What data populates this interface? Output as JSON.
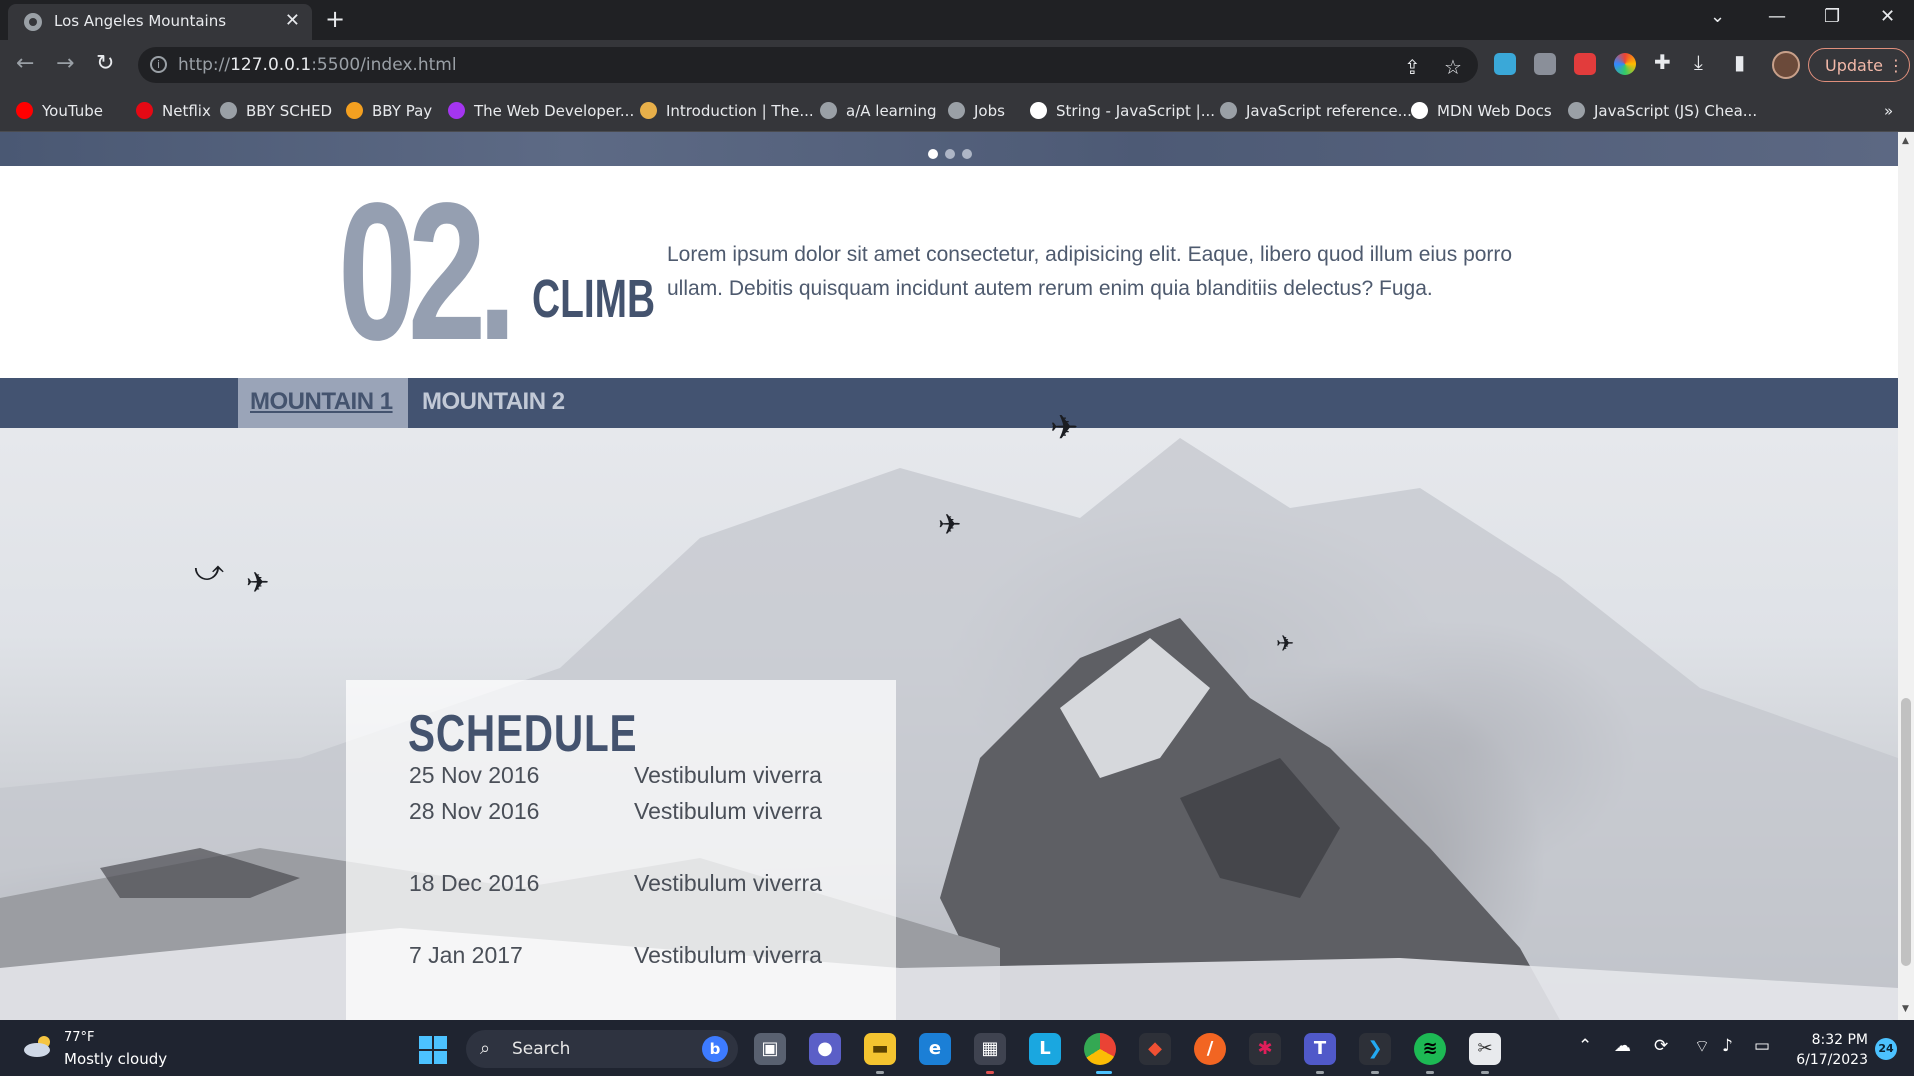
{
  "browser": {
    "tab_title": "Los Angeles Mountains",
    "url_prefix": "http://",
    "url_host": "127.0.0.1",
    "url_rest": ":5500/index.html",
    "update_label": "Update",
    "bookmarks": [
      {
        "label": "YouTube",
        "color": "#ff0000"
      },
      {
        "label": "Netflix",
        "color": "#e50914"
      },
      {
        "label": "BBY SCHED",
        "color": "#9aa0a6"
      },
      {
        "label": "BBY Pay",
        "color": "#f4a020"
      },
      {
        "label": "The Web Developer...",
        "color": "#a435f0"
      },
      {
        "label": "Introduction | The...",
        "color": "#e8b04a"
      },
      {
        "label": "a/A learning",
        "color": "#9aa0a6"
      },
      {
        "label": "Jobs",
        "color": "#9aa0a6"
      },
      {
        "label": "String - JavaScript |...",
        "color": "#ffffff"
      },
      {
        "label": "JavaScript reference...",
        "color": "#9aa0a6"
      },
      {
        "label": "MDN Web Docs",
        "color": "#ffffff"
      },
      {
        "label": "JavaScript (JS) Chea...",
        "color": "#9aa0a6"
      }
    ],
    "bookmarks_overflow": "»"
  },
  "page": {
    "carousel_dots": 3,
    "carousel_active": 1,
    "step_number": "02.",
    "step_label": "CLIMB",
    "step_text": "Lorem ipsum dolor sit amet consectetur, adipisicing elit. Eaque, libero quod illum eius porro ullam. Debitis quisquam incidunt autem rerum enim quia blanditiis delectus? Fuga.",
    "tabs": [
      "MOUNTAIN 1",
      "MOUNTAIN 2"
    ],
    "active_tab": 0,
    "schedule": {
      "title": "SCHEDULE",
      "rows": [
        {
          "date": "25 Nov 2016",
          "desc": "Vestibulum viverra"
        },
        {
          "date": "28 Nov 2016",
          "desc": "Vestibulum viverra"
        },
        {
          "date": "18 Dec 2016",
          "desc": "Vestibulum viverra"
        },
        {
          "date": "7 Jan 2017",
          "desc": "Vestibulum viverra"
        }
      ]
    }
  },
  "taskbar": {
    "weather_temp": "77°F",
    "weather_desc": "Mostly cloudy",
    "search_label": "Search",
    "time": "8:32 PM",
    "date": "6/17/2023",
    "notification_count": "24"
  },
  "colors": {
    "accent": "#44536e",
    "tabs_bar": "#435371",
    "step_number": "#959fb1"
  }
}
